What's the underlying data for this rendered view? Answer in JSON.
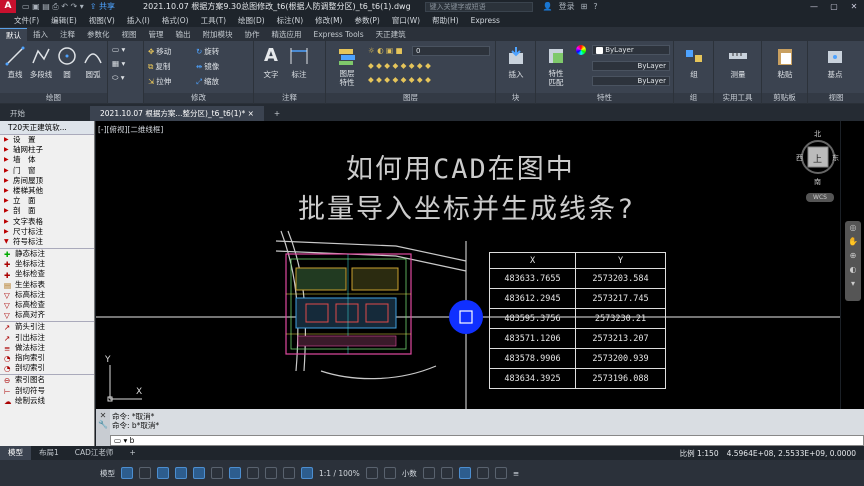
{
  "titlebar": {
    "logo": "A",
    "share": "共享",
    "doc_title": "2021.10.07 根据方案9.30总图修改_t6(根据人防调整分区)_t6_t6(1).dwg",
    "search_placeholder": "键入关键字或短语",
    "login": "登录"
  },
  "menu": [
    "文件(F)",
    "编辑(E)",
    "视图(V)",
    "插入(I)",
    "格式(O)",
    "工具(T)",
    "绘图(D)",
    "标注(N)",
    "修改(M)",
    "参数(P)",
    "窗口(W)",
    "帮助(H)",
    "Express"
  ],
  "ribbon_tabs": [
    "默认",
    "插入",
    "注释",
    "参数化",
    "视图",
    "管理",
    "输出",
    "附加模块",
    "协作",
    "精选应用",
    "Express Tools",
    "天正建筑"
  ],
  "ribbon": {
    "draw": {
      "title": "绘图",
      "line": "直线",
      "polyline": "多段线",
      "circle": "圆",
      "arc": "圆弧"
    },
    "modify": {
      "title": "修改",
      "move": "移动",
      "rotate": "旋转",
      "copy": "复制",
      "mirror": "镜像",
      "stretch": "拉伸",
      "scale": "缩放"
    },
    "annotation": {
      "title": "注释",
      "text": "文字",
      "dim": "标注"
    },
    "layers": {
      "title": "图层",
      "props": "图层\n特性",
      "current": "0"
    },
    "block": {
      "title": "块",
      "insert": "插入"
    },
    "properties": {
      "title": "特性",
      "match": "特性\n匹配",
      "bylayer1": "ByLayer",
      "bylayer2": "ByLayer",
      "bylayer3": "ByLayer"
    },
    "groups": {
      "title": "组",
      "group": "组"
    },
    "utilities": {
      "title": "实用工具",
      "measure": "测量"
    },
    "clipboard": {
      "title": "剪贴板",
      "paste": "粘贴"
    },
    "view": {
      "title": "视图",
      "base": "基点"
    }
  },
  "file_tabs": [
    "开始",
    "2021.10.07 根据方案...整分区)_t6_t6(1)*"
  ],
  "palette": {
    "header": "T20天正建筑软...",
    "items": [
      "设　置",
      "轴网柱子",
      "墙　体",
      "门　窗",
      "房间屋顶",
      "楼梯其他",
      "立　面",
      "剖　面",
      "文字表格",
      "尺寸标注",
      "符号标注"
    ],
    "sub_items": [
      "静态标注",
      "坐标标注",
      "坐标检查",
      "生坐标表",
      "标高标注",
      "标高检查",
      "标高对齐"
    ],
    "sub_items2": [
      "箭头引注",
      "引出标注",
      "做法标注",
      "指向索引",
      "剖切索引"
    ],
    "sub_items3": [
      "索引图名",
      "剖切符号",
      "绘制云线"
    ]
  },
  "viewport": {
    "label": "[-][俯视][二维线框]",
    "title_line1": "如何用CAD在图中",
    "title_line2": "批量导入坐标并生成线条?",
    "compass": {
      "n": "北",
      "s": "南",
      "e": "东",
      "w": "西",
      "top": "上",
      "wcs": "WCS"
    },
    "ucs_y": "Y",
    "ucs_x": "X"
  },
  "table": {
    "headers": [
      "X",
      "Y"
    ],
    "rows": [
      [
        "483633.7655",
        "2573203.584"
      ],
      [
        "483612.2945",
        "2573217.745"
      ],
      [
        "483595.3756",
        "2573230.21"
      ],
      [
        "483571.1206",
        "2573213.207"
      ],
      [
        "483578.9906",
        "2573200.939"
      ],
      [
        "483634.3925",
        "2573196.088"
      ]
    ]
  },
  "command": {
    "history1": "命令: *取消*",
    "history2": "命令: b*取消*",
    "input": "b"
  },
  "layout_tabs": [
    "模型",
    "布局1",
    "CAD江老师"
  ],
  "scale": {
    "label": "比例 1:150",
    "coords": "4.5964E+08, 2.5533E+09, 0.0000"
  },
  "status": {
    "model": "模型",
    "scale": "1:1 / 100%",
    "units": "小数"
  },
  "colors": {
    "accent": "#4ea3ff",
    "palette_bg": "#f0f0f0",
    "ribbon_bg": "#3b4350",
    "viewport_bg": "#000000",
    "blue_grip": "#1030ff"
  }
}
